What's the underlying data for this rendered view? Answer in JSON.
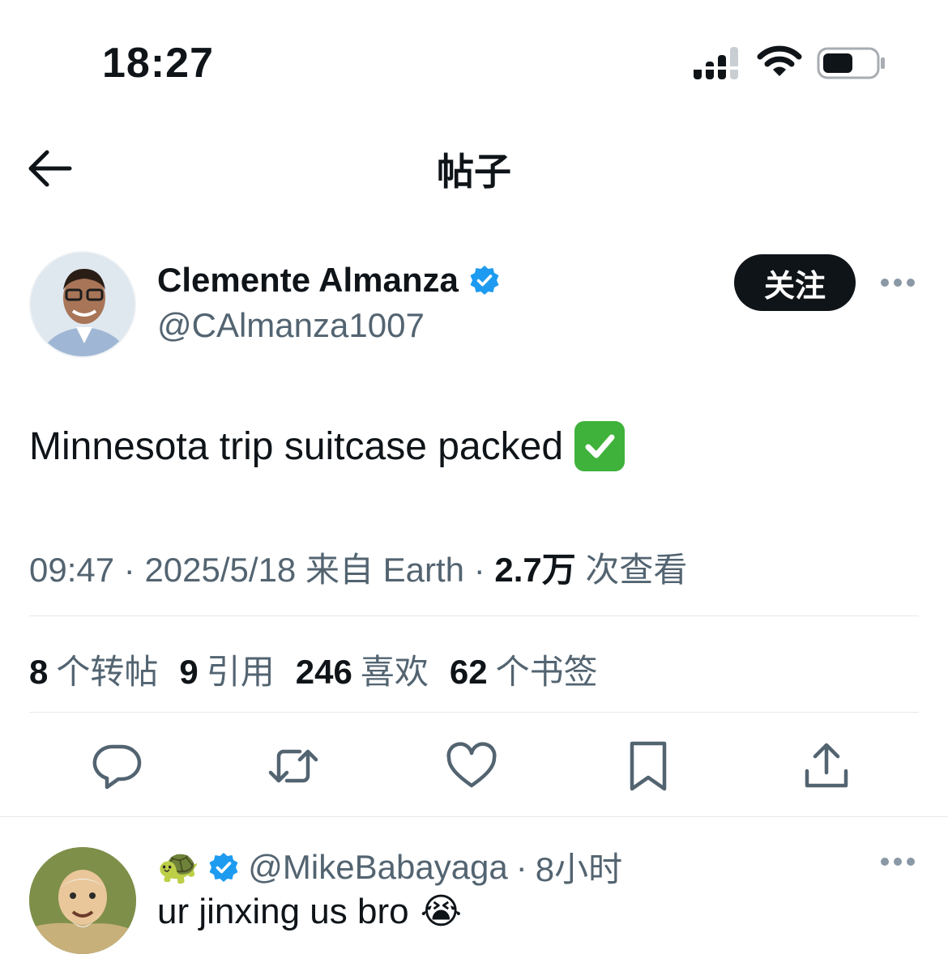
{
  "status_bar": {
    "time": "18:27"
  },
  "nav": {
    "title": "帖子"
  },
  "author": {
    "name": "Clemente Almanza",
    "handle": "@CAlmanza1007",
    "follow_label": "关注"
  },
  "post": {
    "text": "Minnesota trip suitcase packed",
    "emoji": "white-heavy-check-mark"
  },
  "meta": {
    "time": "09:47",
    "sep": " · ",
    "date": "2025/5/18",
    "source": "来自 Earth",
    "views_count": "2.7万",
    "views_label": "次查看"
  },
  "stats": {
    "reposts_count": "8",
    "reposts_label": "个转帖",
    "quotes_count": "9",
    "quotes_label": "引用",
    "likes_count": "246",
    "likes_label": "喜欢",
    "bookmarks_count": "62",
    "bookmarks_label": "个书签"
  },
  "reply": {
    "display_emoji": "🐢",
    "handle": "@MikeBabayaga",
    "sep": "·",
    "time": "8小时",
    "text": "ur jinxing us bro",
    "emoji": "😭"
  },
  "colors": {
    "text": "#0f1419",
    "secondary": "#536471",
    "verified": "#1d9bf0",
    "check_emoji": "#3fb23b"
  },
  "icons": [
    "back-arrow-icon",
    "verified-badge-icon",
    "more-icon",
    "reply-icon",
    "repost-icon",
    "like-icon",
    "bookmark-icon",
    "share-icon",
    "signal-icon",
    "wifi-icon",
    "battery-icon"
  ]
}
